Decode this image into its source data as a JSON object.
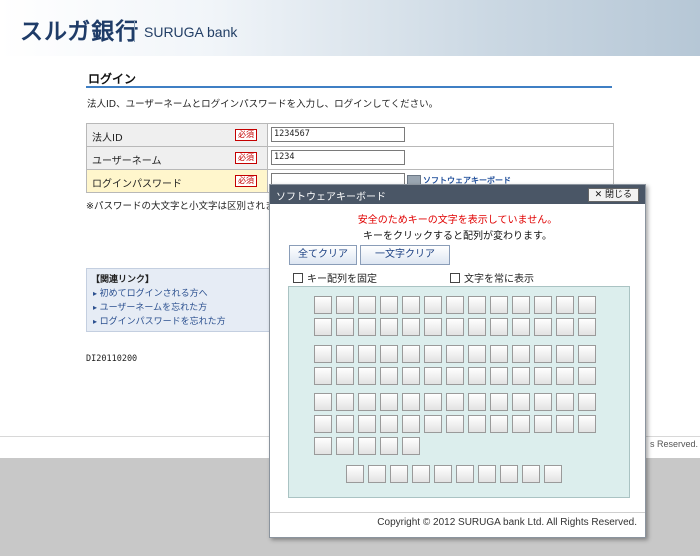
{
  "header": {
    "logo_jp": "スルガ銀行",
    "logo_en": "SURUGA bank"
  },
  "login": {
    "title": "ログイン",
    "intro": "法人ID、ユーザーネームとログインパスワードを入力し、ログインしてください。",
    "required_badge": "必須",
    "fields": {
      "corp_id": {
        "label": "法人ID",
        "value": "1234567"
      },
      "username": {
        "label": "ユーザーネーム",
        "value": "1234"
      },
      "password": {
        "label": "ログインパスワード",
        "value": ""
      }
    },
    "software_keyboard_link": "ソフトウェアキーボード",
    "note": "※パスワードの大文字と小文字は区別されます"
  },
  "related": {
    "title": "【関連リンク】",
    "links": [
      "初めてログインされる方へ",
      "ユーザーネームを忘れた方",
      "ログインパスワードを忘れた方"
    ]
  },
  "page_id": "DI20110200",
  "footer_right": "s Reserved.",
  "modal": {
    "title": "ソフトウェアキーボード",
    "close_label": "✕ 閉じる",
    "warning": "安全のためキーの文字を表示していません。",
    "info": "キーをクリックすると配列が変わります。",
    "clear_all": "全てクリア",
    "clear_one": "一文字クリア",
    "fix_layout": "キー配列を固定",
    "always_show": "文字を常に表示",
    "copyright": "Copyright © 2012 SURUGA bank Ltd. All Rights Reserved.",
    "key_rows": [
      13,
      13,
      13,
      13,
      13,
      13,
      5,
      10
    ]
  }
}
